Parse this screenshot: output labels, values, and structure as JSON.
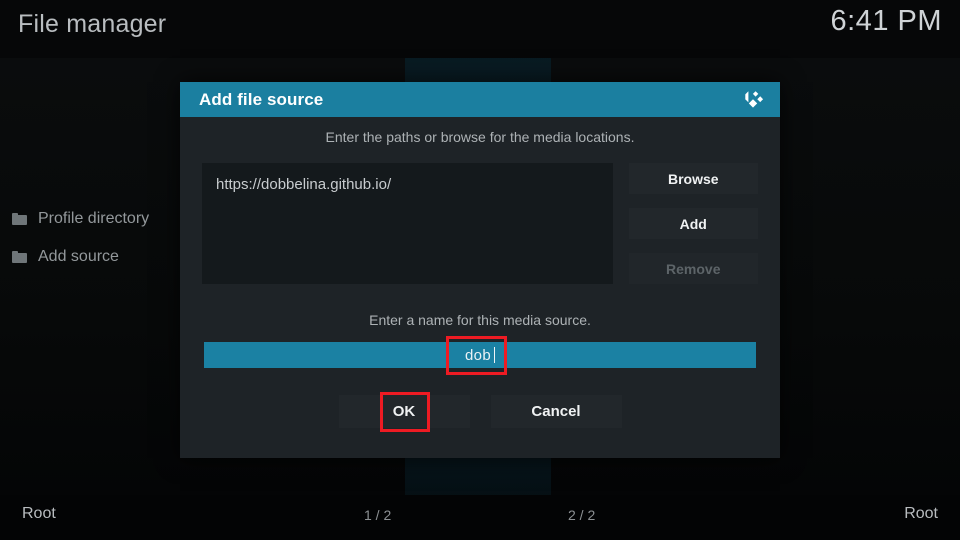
{
  "header": {
    "app_title": "File manager",
    "clock": "6:41 PM"
  },
  "sidebar": {
    "items": [
      {
        "label": "Profile directory",
        "icon": "folder-icon"
      },
      {
        "label": "Add source",
        "icon": "folder-icon"
      }
    ]
  },
  "dialog": {
    "title": "Add file source",
    "logo_icon": "kodi-logo-icon",
    "paths_hint": "Enter the paths or browse for the media locations.",
    "path_value": "https://dobbelina.github.io/",
    "side_buttons": [
      {
        "label": "Browse",
        "enabled": true
      },
      {
        "label": "Add",
        "enabled": true
      },
      {
        "label": "Remove",
        "enabled": false
      }
    ],
    "name_hint": "Enter a name for this media source.",
    "name_value": "dob",
    "bottom_buttons": [
      {
        "label": "OK"
      },
      {
        "label": "Cancel"
      }
    ]
  },
  "statusbar": {
    "left_root": "Root",
    "left_count": "1 / 2",
    "right_count": "2 / 2",
    "right_root": "Root"
  },
  "colors": {
    "accent": "#1b7fa0",
    "field_accent": "#1b81a3",
    "annotation": "#ee1b23",
    "dialog_bg": "#1e2327",
    "button_bg": "#22272b",
    "page_bg": "#050607"
  }
}
